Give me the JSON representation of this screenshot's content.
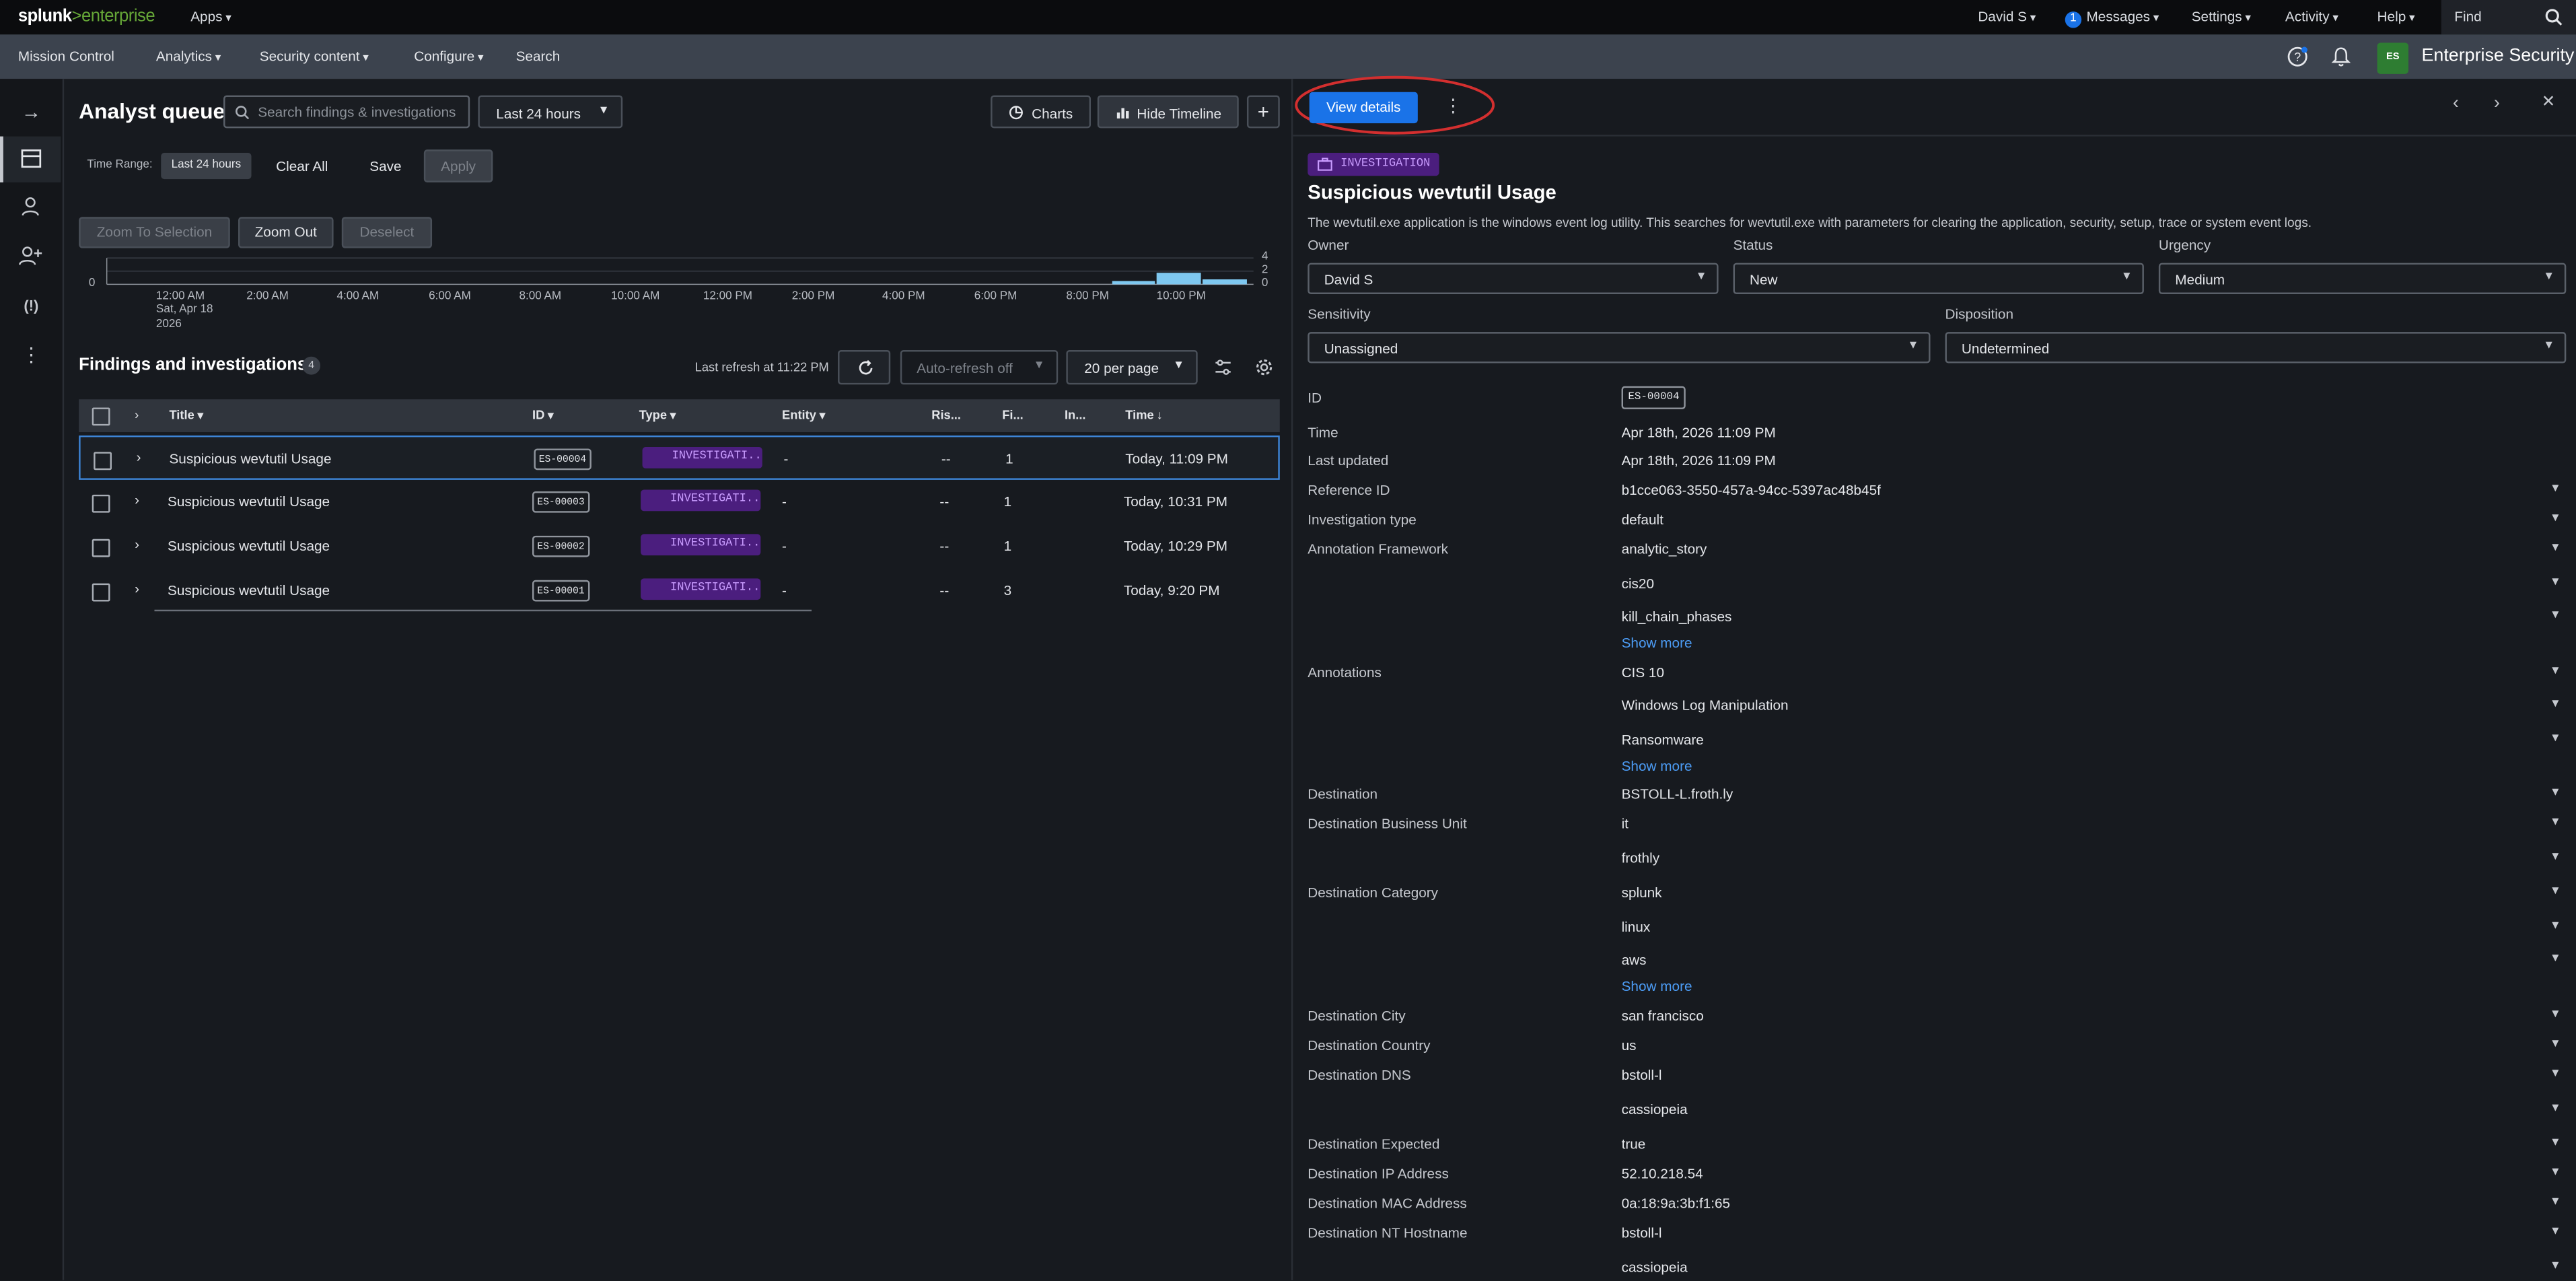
{
  "topbar": {
    "logo_splunk": "splunk",
    "logo_gt": ">",
    "logo_enterprise": "enterprise",
    "apps": "Apps",
    "user": "David S",
    "messages_count": "1",
    "messages": "Messages",
    "settings": "Settings",
    "activity": "Activity",
    "help": "Help",
    "find": "Find"
  },
  "nav": {
    "items": [
      "Mission Control",
      "Analytics",
      "Security content",
      "Configure",
      "Search"
    ],
    "app_badge": "ES",
    "app_title": "Enterprise Security"
  },
  "queue": {
    "title": "Analyst queue",
    "search_placeholder": "Search findings & investigations",
    "time_select": "Last 24 hours",
    "charts_button": "Charts",
    "hide_timeline_button": "Hide Timeline",
    "add_button": "+",
    "time_range_label": "Time Range:",
    "time_range_value": "Last 24 hours",
    "clear_all": "Clear All",
    "save": "Save",
    "apply": "Apply",
    "zoom_to_selection": "Zoom To Selection",
    "zoom_out": "Zoom Out",
    "deselect": "Deselect",
    "timeline": {
      "y_ticks_right": [
        "4",
        "2",
        "0"
      ],
      "y_tick_left": "0",
      "x_ticks": [
        "12:00 AM",
        "2:00 AM",
        "4:00 AM",
        "6:00 AM",
        "8:00 AM",
        "10:00 AM",
        "12:00 PM",
        "2:00 PM",
        "4:00 PM",
        "6:00 PM",
        "8:00 PM",
        "10:00 PM"
      ],
      "x_sub1": "Sat, Apr 18",
      "x_sub2": "2026"
    },
    "findings_title": "Findings and investigations",
    "findings_count": "4",
    "last_refresh": "Last refresh at 11:22 PM",
    "auto_refresh": "Auto-refresh off",
    "per_page": "20 per page",
    "columns": [
      "Title",
      "ID",
      "Type",
      "Entity",
      "Ris...",
      "Fi...",
      "In...",
      "Time"
    ],
    "rows": [
      {
        "title": "Suspicious wevtutil Usage",
        "id": "ES-00004",
        "type": "INVESTIGATI...",
        "entity": "-",
        "risk": "--",
        "findings": "1",
        "time": "Today, 11:09 PM"
      },
      {
        "title": "Suspicious wevtutil Usage",
        "id": "ES-00003",
        "type": "INVESTIGATI...",
        "entity": "-",
        "risk": "--",
        "findings": "1",
        "time": "Today, 10:31 PM"
      },
      {
        "title": "Suspicious wevtutil Usage",
        "id": "ES-00002",
        "type": "INVESTIGATI...",
        "entity": "-",
        "risk": "--",
        "findings": "1",
        "time": "Today, 10:29 PM"
      },
      {
        "title": "Suspicious wevtutil Usage",
        "id": "ES-00001",
        "type": "INVESTIGATI...",
        "entity": "-",
        "risk": "--",
        "findings": "3",
        "time": "Today, 9:20 PM"
      }
    ]
  },
  "detail": {
    "view_details": "View details",
    "type_tag": "INVESTIGATION",
    "title": "Suspicious wevtutil Usage",
    "description": "The wevtutil.exe application is the windows event log utility. This searches for wevtutil.exe with parameters for clearing the application, security, setup, trace or system event logs.",
    "owner_label": "Owner",
    "owner": "David S",
    "status_label": "Status",
    "status": "New",
    "urgency_label": "Urgency",
    "urgency": "Medium",
    "sensitivity_label": "Sensitivity",
    "sensitivity": "Unassigned",
    "disposition_label": "Disposition",
    "disposition": "Undetermined",
    "show_more": "Show more",
    "fields": {
      "id_label": "ID",
      "id": "ES-00004",
      "time_label": "Time",
      "time": "Apr 18th, 2026 11:09 PM",
      "updated_label": "Last updated",
      "updated": "Apr 18th, 2026 11:09 PM",
      "ref_label": "Reference ID",
      "ref": "b1cce063-3550-457a-94cc-5397ac48b45f",
      "inv_type_label": "Investigation type",
      "inv_type": "default",
      "ann_fw_label": "Annotation Framework",
      "ann_fw": [
        "analytic_story",
        "cis20",
        "kill_chain_phases"
      ],
      "ann_label": "Annotations",
      "ann": [
        "CIS 10",
        "Windows Log Manipulation",
        "Ransomware"
      ],
      "dest_label": "Destination",
      "dest": "BSTOLL-L.froth.ly",
      "dest_bu_label": "Destination Business Unit",
      "dest_bu": [
        "it",
        "frothly"
      ],
      "dest_cat_label": "Destination Category",
      "dest_cat": [
        "splunk",
        "linux",
        "aws"
      ],
      "dest_city_label": "Destination City",
      "dest_city": "san francisco",
      "dest_country_label": "Destination Country",
      "dest_country": "us",
      "dest_dns_label": "Destination DNS",
      "dest_dns": [
        "bstoll-l",
        "cassiopeia"
      ],
      "dest_exp_label": "Destination Expected",
      "dest_exp": "true",
      "dest_ip_label": "Destination IP Address",
      "dest_ip": "52.10.218.54",
      "dest_mac_label": "Destination MAC Address",
      "dest_mac": "0a:18:9a:3b:f1:65",
      "dest_nt_label": "Destination NT Hostname",
      "dest_nt": [
        "bstoll-l",
        "cassiopeia"
      ]
    }
  },
  "colors": {
    "accent": "#1a73e8",
    "investigation_tag_bg": "#4b1e7e",
    "investigation_tag_fg": "#c99cff",
    "brand_green": "#65a637",
    "annotation_circle": "#d32f2f"
  }
}
